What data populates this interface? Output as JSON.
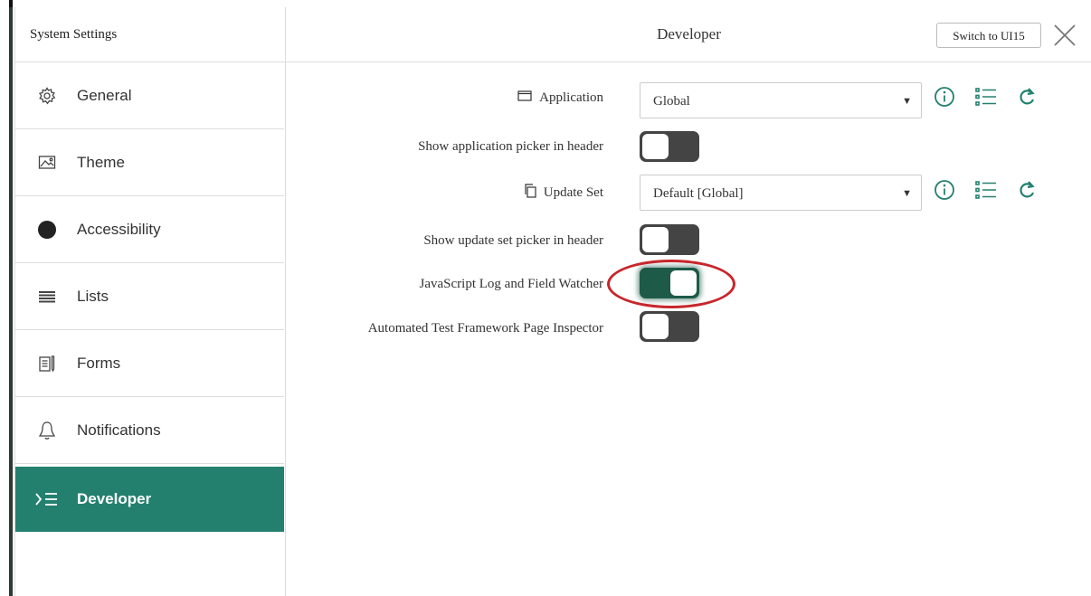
{
  "sidebar": {
    "title": "System Settings",
    "items": [
      {
        "label": "General",
        "icon": "gear-icon"
      },
      {
        "label": "Theme",
        "icon": "image-icon"
      },
      {
        "label": "Accessibility",
        "icon": "circle-icon"
      },
      {
        "label": "Lists",
        "icon": "list-table-icon"
      },
      {
        "label": "Forms",
        "icon": "form-icon"
      },
      {
        "label": "Notifications",
        "icon": "bell-icon"
      },
      {
        "label": "Developer",
        "icon": "sigma-list-icon",
        "active": true
      }
    ]
  },
  "header": {
    "title": "Developer",
    "switch_label": "Switch to UI15",
    "close_icon": "close-icon"
  },
  "settings": {
    "application": {
      "label": "Application",
      "value": "Global",
      "icon": "window-icon"
    },
    "show_app_picker": {
      "label": "Show application picker in header",
      "on": false
    },
    "update_set": {
      "label": "Update Set",
      "value": "Default [Global]",
      "icon": "copy-icon"
    },
    "show_update_set_picker": {
      "label": "Show update set picker in header",
      "on": false
    },
    "js_log": {
      "label": "JavaScript Log and Field Watcher",
      "on": true
    },
    "atf_inspector": {
      "label": "Automated Test Framework Page Inspector",
      "on": false
    }
  },
  "colors": {
    "accent": "#23806e",
    "toggle_on": "#1d5a47",
    "toggle_off": "#444444",
    "highlight": "#c7262b"
  }
}
